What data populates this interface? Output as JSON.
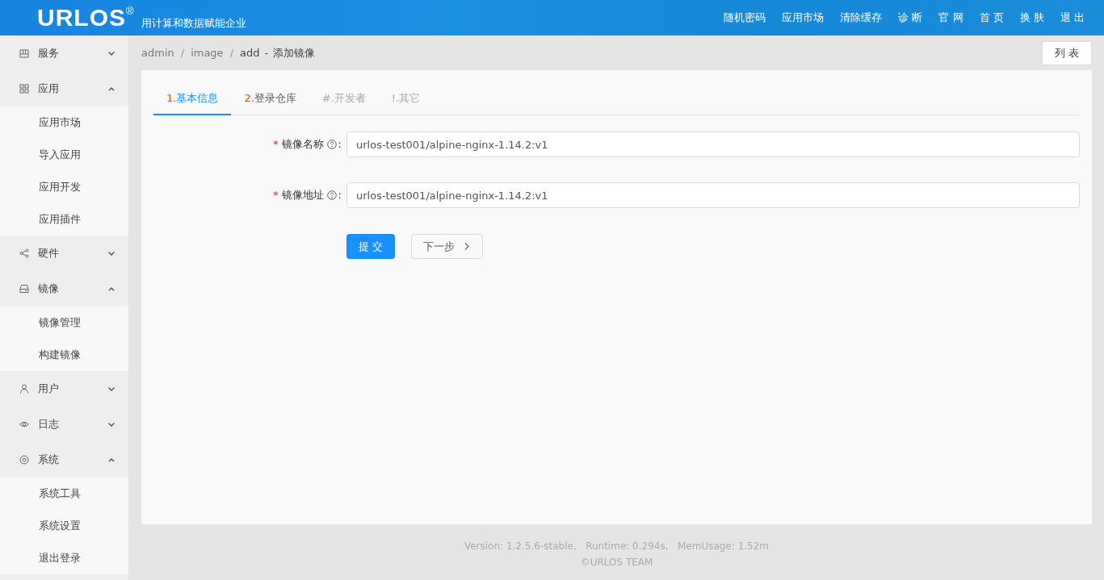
{
  "header": {
    "logo": "URLOS$^{®}$",
    "slogan": "用计算和数据赋能企业",
    "nav": [
      "随机密码",
      "应用市场",
      "清除缓存",
      "诊 断",
      "官 网",
      "首 页",
      "换 肤",
      "退 出"
    ]
  },
  "sidebar": {
    "groups": [
      {
        "label": "服务",
        "expanded": false
      },
      {
        "label": "应用",
        "expanded": true,
        "children": [
          {
            "label": "应用市场"
          },
          {
            "label": "导入应用"
          },
          {
            "label": "应用开发"
          },
          {
            "label": "应用插件"
          }
        ]
      },
      {
        "label": "硬件",
        "expanded": false
      },
      {
        "label": "镜像",
        "expanded": true,
        "children": [
          {
            "label": "镜像管理"
          },
          {
            "label": "构建镜像"
          }
        ]
      },
      {
        "label": "用户",
        "expanded": false
      },
      {
        "label": "日志",
        "expanded": false
      },
      {
        "label": "系统",
        "expanded": true,
        "children": [
          {
            "label": "系统工具"
          },
          {
            "label": "系统设置"
          },
          {
            "label": "退出登录"
          }
        ]
      }
    ]
  },
  "breadcrumb": [
    {
      "text": "admin",
      "kind": "link"
    },
    {
      "text": "/",
      "kind": "sep"
    },
    {
      "text": "image",
      "kind": "link"
    },
    {
      "text": "/",
      "kind": "sep"
    },
    {
      "text": "add",
      "kind": "current"
    },
    {
      "text": "-",
      "kind": "current"
    },
    {
      "text": "添加镜像",
      "kind": "current"
    }
  ],
  "list_button": "列 表",
  "tabs": [
    {
      "number": "1.",
      "label": "基本信息",
      "selected": true,
      "disabled": false
    },
    {
      "number": "2.",
      "label": "登录仓库",
      "selected": false,
      "disabled": false
    },
    {
      "number": "#.",
      "label": "开发者",
      "selected": false,
      "disabled": true
    },
    {
      "number": "!.",
      "label": "其它",
      "selected": false,
      "disabled": true
    }
  ],
  "form": {
    "fields": [
      {
        "label": "镜像名称",
        "required": true,
        "value": "urlos-test001/alpine-nginx-1.14.2:v1"
      },
      {
        "label": "镜像地址",
        "required": true,
        "value": "urlos-test001/alpine-nginx-1.14.2:v1"
      }
    ],
    "required_mark": "*",
    "colon": ":",
    "submit": "提 交",
    "next": "下一步"
  },
  "footer": {
    "stats": "Version: 1.2.5.6-stable,   Runtime: 0.294s,   MemUsage: 1.52m",
    "copyright": "©URLOS TEAM"
  }
}
